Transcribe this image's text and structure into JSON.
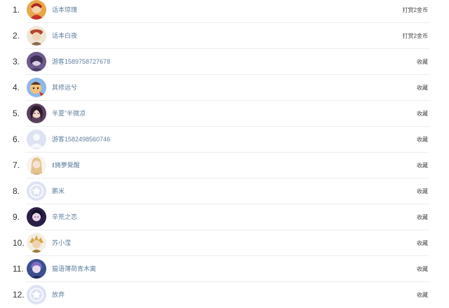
{
  "colors": {
    "name_link": "#5f7f9c",
    "rank_text": "#333333",
    "action_text": "#444444",
    "divider": "#ededed",
    "default_avatar_bg": "#dde3f1"
  },
  "rows": [
    {
      "rank": "1.",
      "name": "话本琼瑰",
      "action": "打赏2金币",
      "avatar": "red-costume-avatar-icon"
    },
    {
      "rank": "2.",
      "name": "话本白夜",
      "action": "打赏2金币",
      "avatar": "hat-figure-avatar-icon"
    },
    {
      "rank": "3.",
      "name": "游客1589758727678",
      "action": "收藏",
      "avatar": "purple-anime-avatar-icon"
    },
    {
      "rank": "4.",
      "name": "其修远兮",
      "action": "收藏",
      "avatar": "cartoon-face-avatar-icon"
    },
    {
      "rank": "5.",
      "name": "半夏”半微凉",
      "action": "收藏",
      "avatar": "dark-hair-girl-avatar-icon"
    },
    {
      "rank": "6.",
      "name": "游客1582498560746",
      "action": "收藏",
      "avatar": "default-person-avatar-icon"
    },
    {
      "rank": "7.",
      "name": "‖旖夢覺醒",
      "action": "收藏",
      "avatar": "blonde-girl-avatar-icon"
    },
    {
      "rank": "8.",
      "name": "鹏米",
      "action": "收藏",
      "avatar": "default-star-avatar-icon"
    },
    {
      "rank": "9.",
      "name": "辛荒之恋",
      "action": "收藏",
      "avatar": "dark-purple-avatar-icon"
    },
    {
      "rank": "10.",
      "name": "苏小滢",
      "action": "收藏",
      "avatar": "golden-spiky-avatar-icon"
    },
    {
      "rank": "11.",
      "name": "猫语薄荷青木离",
      "action": "收藏",
      "avatar": "blue-anime-avatar-icon"
    },
    {
      "rank": "12.",
      "name": "放弃",
      "action": "收藏",
      "avatar": "default-star-avatar-icon"
    }
  ]
}
